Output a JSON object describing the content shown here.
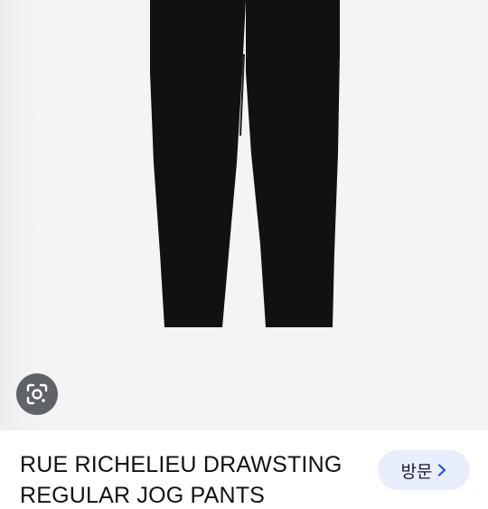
{
  "product": {
    "title_line1": "RUE RICHELIEU DRAWSTING",
    "title_line2": "REGULAR JOG PANTS"
  },
  "actions": {
    "visit_label": "방문",
    "visit_icon": "chevron-right-icon",
    "lens_icon": "google-lens-icon"
  },
  "colors": {
    "image_bg": "#f4f4f4",
    "pants": "#111111",
    "lens_bg": "#5f6368",
    "visit_bg": "#e8eefc",
    "accent": "#1a56db"
  }
}
